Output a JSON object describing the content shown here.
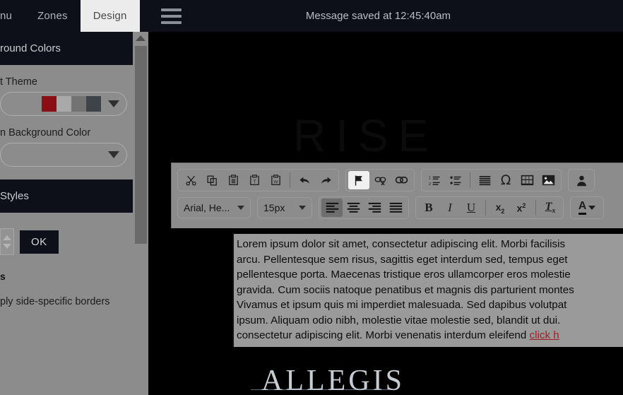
{
  "topbar": {
    "tabs": [
      {
        "label": "nu",
        "active": false
      },
      {
        "label": "Zones",
        "active": false
      },
      {
        "label": "Design",
        "active": true
      }
    ],
    "menu_icon": "hamburger-icon",
    "status_message": "Message saved at 12:45:40am"
  },
  "sidebar": {
    "sections": [
      {
        "title": "round Colors"
      },
      {
        "title": "Styles"
      }
    ],
    "fields": [
      {
        "label": "t Theme",
        "type": "color-theme-select",
        "swatches": [
          "#8a0e14",
          "#a9a9a9",
          "#737373",
          "#3e4249"
        ]
      },
      {
        "label": "n Background Color",
        "type": "select",
        "value": ""
      }
    ],
    "ok_button": "OK",
    "bold_label": "s",
    "borders_label": "ply side-specific borders",
    "scrollbar": {
      "up_arrow": "scroll-up-arrow"
    }
  },
  "stage": {
    "ghost_text": "RISE",
    "logo_text": "ALLEGIS"
  },
  "editor": {
    "toolbar": {
      "row1_group1": [
        {
          "name": "cut-icon",
          "title": "Cut"
        },
        {
          "name": "copy-icon",
          "title": "Copy"
        },
        {
          "name": "paste-icon",
          "title": "Paste"
        },
        {
          "name": "paste-text-icon",
          "title": "Paste as plain text"
        },
        {
          "name": "paste-word-icon",
          "title": "Paste from Word"
        },
        {
          "name": "undo-icon",
          "title": "Undo"
        },
        {
          "name": "redo-icon",
          "title": "Redo"
        }
      ],
      "row1_group2": [
        {
          "name": "anchor-flag-icon",
          "title": "Anchor",
          "active": true
        },
        {
          "name": "unlink-icon",
          "title": "Unlink"
        },
        {
          "name": "link-icon",
          "title": "Link"
        }
      ],
      "row1_group3": [
        {
          "name": "numbered-list-icon",
          "title": "Insert/Remove Numbered List"
        },
        {
          "name": "bulleted-list-icon",
          "title": "Insert/Remove Bulleted List"
        },
        {
          "name": "blockquote-icon",
          "title": "Block Quote"
        },
        {
          "name": "special-char-icon",
          "title": "Insert Special Character",
          "glyph": "Ω"
        },
        {
          "name": "table-icon",
          "title": "Table"
        },
        {
          "name": "image-icon",
          "title": "Image"
        }
      ],
      "row1_group4": [
        {
          "name": "user-icon",
          "title": "Personalization"
        }
      ],
      "font_family": "Arial, He...",
      "font_size": "15px",
      "alignment": [
        {
          "name": "align-left-icon",
          "title": "Align Left",
          "active": true
        },
        {
          "name": "align-center-icon",
          "title": "Center",
          "active": false
        },
        {
          "name": "align-right-icon",
          "title": "Align Right",
          "active": false
        },
        {
          "name": "justify-icon",
          "title": "Justify",
          "active": false
        }
      ],
      "format": [
        {
          "name": "bold-icon",
          "label": "B"
        },
        {
          "name": "italic-icon",
          "label": "I"
        },
        {
          "name": "underline-icon",
          "label": "U"
        },
        {
          "name": "subscript-icon",
          "label": "x"
        },
        {
          "name": "superscript-icon",
          "label": "x"
        },
        {
          "name": "remove-format-icon",
          "label": "T"
        }
      ],
      "text_color": {
        "name": "text-color-icon",
        "label": "A"
      }
    },
    "body_lines": [
      "Lorem ipsum dolor sit amet, consectetur adipiscing elit. Morbi facilisis",
      "arcu. Pellentesque sem risus, sagittis eget interdum sed, tempus eget",
      "pellentesque porta. Maecenas tristique eros ullamcorper eros molestie",
      "gravida. Cum sociis natoque penatibus et magnis dis parturient montes",
      "Vivamus et ipsum quis mi imperdiet malesuada. Sed dapibus volutpat",
      "ipsum. Aliquam odio nibh, molestie vitae molestie sed, blandit ut dui.",
      "consectetur adipiscing elit. Morbi venenatis interdum eleifend "
    ],
    "body_link_text": "click h"
  },
  "colors": {
    "topbar_bg": "#0d1019",
    "active_tab_bg": "#ececec",
    "panel_bg": "#8c8c8c",
    "toolbar_bg": "#8c8c8c",
    "accent_red": "#8a0e14",
    "link_red": "#9e1f23",
    "stage_bg": "#000000"
  }
}
